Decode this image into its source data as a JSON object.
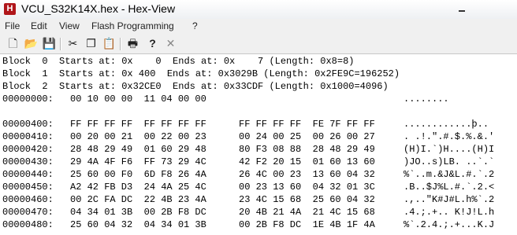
{
  "window": {
    "title": "VCU_S32K14X.hex - Hex-View",
    "app_icon_letter": "H"
  },
  "menu": {
    "items": [
      "File",
      "Edit",
      "View",
      "Flash Programming",
      "?"
    ]
  },
  "toolbar": {
    "buttons": [
      {
        "name": "new-file-icon",
        "glyph": "🗋"
      },
      {
        "name": "open-folder-icon",
        "glyph": "📂"
      },
      {
        "name": "save-icon",
        "glyph": "💾"
      },
      {
        "name": "cut-icon",
        "glyph": "✂"
      },
      {
        "name": "copy-icon",
        "glyph": "❐"
      },
      {
        "name": "paste-icon",
        "glyph": "📋"
      },
      {
        "name": "print-icon",
        "glyph": "🖶"
      },
      {
        "name": "help-icon",
        "glyph": "?"
      },
      {
        "name": "close-icon",
        "glyph": "✕"
      }
    ]
  },
  "blocks": [
    "Block  0  Starts at: 0x    0  Ends at: 0x    7 (Length: 0x8=8)",
    "Block  1  Starts at: 0x 400  Ends at: 0x3029B (Length: 0x2FE9C=196252)",
    "Block  2  Starts at: 0x32CE0  Ends at: 0x33CDF (Length: 0x1000=4096)"
  ],
  "first_row": {
    "addr": "00000000:",
    "hex1": "00 10 00 00  11 04 00 00",
    "hex2": "",
    "ascii": "........"
  },
  "rows": [
    {
      "addr": "00000400:",
      "hex1": "FF FF FF FF  FF FF FF FF",
      "hex2": "FF FF FF FF  FE 7F FF FF",
      "ascii": "............þ.."
    },
    {
      "addr": "00000410:",
      "hex1": "00 20 00 21  00 22 00 23",
      "hex2": "00 24 00 25  00 26 00 27",
      "ascii": ". .!.\".#.$.%.&.'"
    },
    {
      "addr": "00000420:",
      "hex1": "28 48 29 49  01 60 29 48",
      "hex2": "80 F3 08 88  28 48 29 49",
      "ascii": "(H)I.`)H....(H)I"
    },
    {
      "addr": "00000430:",
      "hex1": "29 4A 4F F6  FF 73 29 4C",
      "hex2": "42 F2 20 15  01 60 13 60",
      "ascii": ")JO..s)LB. ..`.`"
    },
    {
      "addr": "00000440:",
      "hex1": "25 60 00 F0  6D F8 26 4A",
      "hex2": "26 4C 00 23  13 60 04 32",
      "ascii": "%`..m.&J&L.#.`.2"
    },
    {
      "addr": "00000450:",
      "hex1": "A2 42 FB D3  24 4A 25 4C",
      "hex2": "00 23 13 60  04 32 01 3C",
      "ascii": ".B..$J%L.#.`.2.<"
    },
    {
      "addr": "00000460:",
      "hex1": "00 2C FA DC  22 4B 23 4A",
      "hex2": "23 4C 15 68  25 60 04 32",
      "ascii": ".,..\"K#J#L.h%`.2"
    },
    {
      "addr": "00000470:",
      "hex1": "04 34 01 3B  00 2B F8 DC",
      "hex2": "20 4B 21 4A  21 4C 15 68",
      "ascii": ".4.;.+.. K!J!L.h"
    },
    {
      "addr": "00000480:",
      "hex1": "25 60 04 32  04 34 01 3B",
      "hex2": "00 2B F8 DC  1E 4B 1F 4A",
      "ascii": "%`.2.4.;.+...K.J"
    }
  ]
}
